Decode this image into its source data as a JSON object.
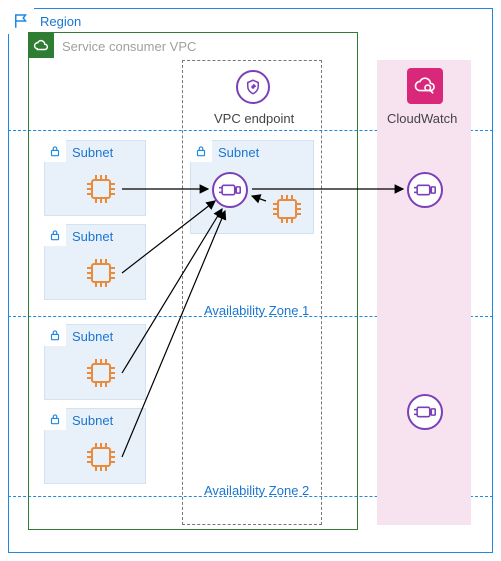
{
  "region": {
    "label": "Region",
    "color": "#1976d2"
  },
  "vpc": {
    "label": "Service consumer VPC",
    "color_border": "#2e7d32",
    "label_color": "#a0a0a0"
  },
  "endpoint": {
    "label": "VPC endpoint"
  },
  "cloudwatch": {
    "label": "CloudWatch",
    "color": "#d9287a"
  },
  "subnets": {
    "label1": "Subnet",
    "label2": "Subnet",
    "label3": "Subnet",
    "label4": "Subnet",
    "label5": "Subnet"
  },
  "az": {
    "label1": "Availability Zone 1",
    "label2": "Availability Zone 2"
  },
  "colors": {
    "blue": "#1976d2",
    "blue_dash": "#1e88e5",
    "orange": "#e98b3a",
    "purple": "#7b3fb8",
    "pink": "#d9287a",
    "green": "#2e7d32",
    "grey": "#888",
    "lightblue_fill": "#e8f1f9",
    "pink_fill": "#f7e2ef"
  }
}
